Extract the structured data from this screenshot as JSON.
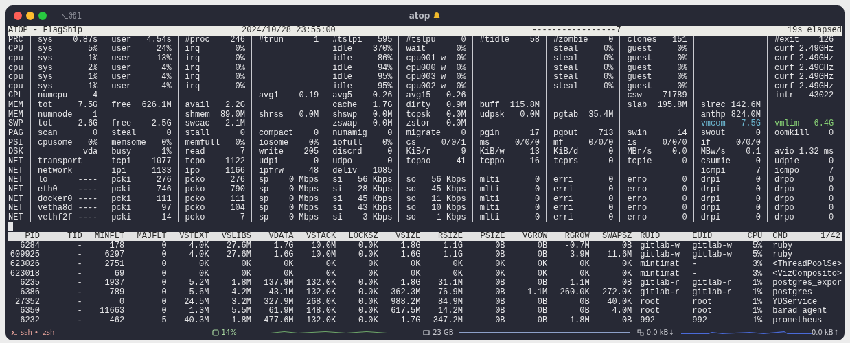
{
  "window": {
    "shortcut": "⌥⌘1",
    "title": "atop"
  },
  "header": {
    "app": "ATOP - FlagShip",
    "datetime": "2024/10/28 23:55:00",
    "interval": "-----------------7",
    "elapsed": "19s elapsed"
  },
  "system": {
    "rows": [
      {
        "label": "PRC",
        "cells": [
          [
            "sys",
            "0.87s"
          ],
          [
            "user",
            "4.54s"
          ],
          [
            "#proc",
            "246"
          ],
          [
            "#trun",
            "1"
          ],
          [
            "#tslpi",
            "595"
          ],
          [
            "#tslpu",
            "0"
          ],
          [
            "#tidle",
            "58"
          ],
          [
            "#zombie",
            "0"
          ],
          [
            "clones",
            "151"
          ],
          null,
          [
            "#exit",
            "126"
          ]
        ]
      },
      {
        "label": "CPU",
        "cells": [
          [
            "sys",
            "5%"
          ],
          [
            "user",
            "24%"
          ],
          [
            "irq",
            "0%"
          ],
          null,
          [
            "idle",
            "370%"
          ],
          [
            "wait",
            "0%"
          ],
          null,
          [
            "steal",
            "0%"
          ],
          [
            "guest",
            "0%"
          ],
          null,
          [
            "curf",
            "2.49GHz"
          ]
        ]
      },
      {
        "label": "cpu",
        "cells": [
          [
            "sys",
            "1%"
          ],
          [
            "user",
            "13%"
          ],
          [
            "irq",
            "0%"
          ],
          null,
          [
            "idle",
            "86%"
          ],
          [
            "cpu001 w",
            "0%"
          ],
          null,
          [
            "steal",
            "0%"
          ],
          [
            "guest",
            "0%"
          ],
          null,
          [
            "curf",
            "2.49GHz"
          ]
        ]
      },
      {
        "label": "cpu",
        "cells": [
          [
            "sys",
            "2%"
          ],
          [
            "user",
            "4%"
          ],
          [
            "irq",
            "0%"
          ],
          null,
          [
            "idle",
            "94%"
          ],
          [
            "cpu000 w",
            "0%"
          ],
          null,
          [
            "steal",
            "0%"
          ],
          [
            "guest",
            "0%"
          ],
          null,
          [
            "curf",
            "2.49GHz"
          ]
        ]
      },
      {
        "label": "cpu",
        "cells": [
          [
            "sys",
            "1%"
          ],
          [
            "user",
            "4%"
          ],
          [
            "irq",
            "0%"
          ],
          null,
          [
            "idle",
            "95%"
          ],
          [
            "cpu003 w",
            "0%"
          ],
          null,
          [
            "steal",
            "0%"
          ],
          [
            "guest",
            "0%"
          ],
          null,
          [
            "curf",
            "2.49GHz"
          ]
        ]
      },
      {
        "label": "cpu",
        "cells": [
          [
            "sys",
            "1%"
          ],
          [
            "user",
            "4%"
          ],
          [
            "irq",
            "0%"
          ],
          null,
          [
            "idle",
            "95%"
          ],
          [
            "cpu002 w",
            "0%"
          ],
          null,
          [
            "steal",
            "0%"
          ],
          [
            "guest",
            "0%"
          ],
          null,
          [
            "curf",
            "2.49GHz"
          ]
        ]
      },
      {
        "label": "CPL",
        "cells": [
          [
            "numcpu",
            "4"
          ],
          null,
          null,
          [
            "avg1",
            "0.19"
          ],
          [
            "avg5",
            "0.26"
          ],
          [
            "avg15",
            "0.26"
          ],
          null,
          null,
          [
            "csw",
            "71789"
          ],
          null,
          [
            "intr",
            "43022"
          ]
        ]
      },
      {
        "label": "MEM",
        "cells": [
          [
            "tot",
            "7.5G"
          ],
          [
            "free",
            "626.1M"
          ],
          [
            "avail",
            "2.2G"
          ],
          null,
          [
            "cache",
            "1.7G"
          ],
          [
            "dirty",
            "0.9M"
          ],
          [
            "buff",
            "115.8M"
          ],
          null,
          [
            "slab",
            "195.8M"
          ],
          [
            "slrec",
            "142.6M"
          ],
          null
        ]
      },
      {
        "label": "MEM",
        "cells": [
          [
            "numnode",
            "1"
          ],
          null,
          [
            "shmem",
            "89.0M"
          ],
          [
            "shrss",
            "0.0M"
          ],
          [
            "shswp",
            "0.0M"
          ],
          [
            "tcpsk",
            "0.0M"
          ],
          [
            "udpsk",
            "0.0M"
          ],
          [
            "pgtab",
            "35.4M"
          ],
          null,
          [
            "anthp",
            "824.0M"
          ],
          null
        ]
      },
      {
        "label": "SWP",
        "cells": [
          [
            "tot",
            "2.6G"
          ],
          [
            "free",
            "2.5G"
          ],
          [
            "swcac",
            "2.1M"
          ],
          null,
          [
            "zswap",
            "0.0M"
          ],
          [
            "zstor",
            "0.0M"
          ],
          null,
          null,
          null,
          {
            "k": "vmcom",
            "v": "7.5G",
            "color": "#6cb6cf"
          },
          {
            "k": "vmlim",
            "v": "6.4G",
            "color": "#86cf74"
          }
        ]
      },
      {
        "label": "PAG",
        "cells": [
          [
            "scan",
            "0"
          ],
          [
            "steal",
            "0"
          ],
          [
            "stall",
            "0"
          ],
          [
            "compact",
            "0"
          ],
          [
            "numamig",
            "0"
          ],
          [
            "migrate",
            "0"
          ],
          [
            "pgin",
            "17"
          ],
          [
            "pgout",
            "713"
          ],
          [
            "swin",
            "14"
          ],
          [
            "swout",
            "0"
          ],
          [
            "oomkill",
            "0"
          ]
        ]
      },
      {
        "label": "PSI",
        "cells": [
          [
            "cpusome",
            "0%"
          ],
          [
            "memsome",
            "0%"
          ],
          [
            "memfull",
            "0%"
          ],
          [
            "iosome",
            "0%"
          ],
          [
            "iofull",
            "0%"
          ],
          [
            "cs",
            "0/0/1"
          ],
          [
            "ms",
            "0/0/0"
          ],
          [
            "mf",
            "0/0/0"
          ],
          [
            "is",
            "0/0/0"
          ],
          [
            "if",
            "0/0/0"
          ],
          null
        ]
      },
      {
        "label": "DSK",
        "cells": [
          [
            null,
            "vda"
          ],
          [
            "busy",
            "1%"
          ],
          [
            "read",
            "7"
          ],
          [
            "write",
            "205"
          ],
          [
            "discrd",
            "0"
          ],
          [
            "KiB/r",
            "9"
          ],
          [
            "KiB/w",
            "13"
          ],
          [
            "KiB/d",
            "0"
          ],
          [
            "MBr/s",
            "0.0"
          ],
          [
            "MBw/s",
            "0.1"
          ],
          [
            "avio",
            "1.32 ms"
          ]
        ]
      },
      {
        "label": "NET",
        "cells": [
          [
            "transport",
            null
          ],
          [
            "tcpi",
            "1077"
          ],
          [
            "tcpo",
            "1122"
          ],
          [
            "udpi",
            "0"
          ],
          [
            "udpo",
            "0"
          ],
          [
            "tcpao",
            "41"
          ],
          [
            "tcppo",
            "16"
          ],
          [
            "tcprs",
            "0"
          ],
          [
            "tcpie",
            "0"
          ],
          [
            "csumie",
            "0"
          ],
          [
            "udpie",
            "0"
          ]
        ]
      },
      {
        "label": "NET",
        "cells": [
          [
            "network",
            null
          ],
          [
            "ipi",
            "1133"
          ],
          [
            "ipo",
            "1166"
          ],
          [
            "ipfrw",
            "48"
          ],
          [
            "deliv",
            "1085"
          ],
          null,
          null,
          null,
          null,
          [
            "icmpi",
            "7"
          ],
          [
            "icmpo",
            "7"
          ]
        ]
      },
      {
        "label": "NET",
        "cells": [
          [
            "lo",
            "----"
          ],
          [
            "pcki",
            "276"
          ],
          [
            "pcko",
            "276"
          ],
          [
            "sp",
            "0 Mbps"
          ],
          [
            "si",
            "56 Kbps"
          ],
          [
            "so",
            "56 Kbps"
          ],
          [
            "mlti",
            "0"
          ],
          [
            "erri",
            "0"
          ],
          [
            "erro",
            "0"
          ],
          [
            "drpi",
            "0"
          ],
          [
            "drpo",
            "0"
          ]
        ]
      },
      {
        "label": "NET",
        "cells": [
          [
            "eth0",
            "----"
          ],
          [
            "pcki",
            "746"
          ],
          [
            "pcko",
            "790"
          ],
          [
            "sp",
            "0 Mbps"
          ],
          [
            "si",
            "28 Kbps"
          ],
          [
            "so",
            "45 Kbps"
          ],
          [
            "mlti",
            "0"
          ],
          [
            "erri",
            "0"
          ],
          [
            "erro",
            "0"
          ],
          [
            "drpi",
            "0"
          ],
          [
            "drpo",
            "0"
          ]
        ]
      },
      {
        "label": "NET",
        "cells": [
          [
            "docker0",
            "----"
          ],
          [
            "pcki",
            "111"
          ],
          [
            "pcko",
            "111"
          ],
          [
            "sp",
            "0 Mbps"
          ],
          [
            "si",
            "45 Kbps"
          ],
          [
            "so",
            "11 Kbps"
          ],
          [
            "mlti",
            "0"
          ],
          [
            "erri",
            "0"
          ],
          [
            "erro",
            "0"
          ],
          [
            "drpi",
            "0"
          ],
          [
            "drpo",
            "0"
          ]
        ]
      },
      {
        "label": "NET",
        "cells": [
          [
            "vetha8d",
            "----"
          ],
          [
            "pcki",
            "97"
          ],
          [
            "pcko",
            "104"
          ],
          [
            "sp",
            "0 Mbps"
          ],
          [
            "si",
            "43 Kbps"
          ],
          [
            "so",
            "10 Kbps"
          ],
          [
            "mlti",
            "0"
          ],
          [
            "erri",
            "0"
          ],
          [
            "erro",
            "0"
          ],
          [
            "drpi",
            "0"
          ],
          [
            "drpo",
            "0"
          ]
        ]
      },
      {
        "label": "NET",
        "cells": [
          [
            "vethf2f",
            "----"
          ],
          [
            "pcki",
            "14"
          ],
          [
            "pcko",
            "7"
          ],
          [
            "sp",
            "0 Mbps"
          ],
          [
            "si",
            "3 Kbps"
          ],
          [
            "so",
            "1 Kbps"
          ],
          [
            "mlti",
            "0"
          ],
          [
            "erri",
            "0"
          ],
          [
            "erro",
            "0"
          ],
          [
            "drpi",
            "0"
          ],
          [
            "drpo",
            "0"
          ]
        ]
      }
    ]
  },
  "process_table": {
    "columns": [
      "PID",
      "TID",
      "MINFLT",
      "MAJFLT",
      "VSTEXT",
      "VSLIBS",
      "VDATA",
      "VSTACK",
      "LOCKSZ",
      "VSIZE",
      "RSIZE",
      "PSIZE",
      "VGROW",
      "RGROW",
      "SWAPSZ",
      "RUID",
      "EUID",
      "CPU",
      "CMD"
    ],
    "page": "1/42",
    "rows": [
      [
        "6284",
        "-",
        "178",
        "0",
        "4.0K",
        "27.6M",
        "1.7G",
        "10.0M",
        "0.0K",
        "1.8G",
        "1.1G",
        "0B",
        "0B",
        "-0.7M",
        "0B",
        "gitlab-w",
        "gitlab-w",
        "5%",
        "ruby"
      ],
      [
        "609925",
        "-",
        "6297",
        "0",
        "4.0K",
        "27.6M",
        "1.6G",
        "10.0M",
        "0.0K",
        "1.6G",
        "1.1G",
        "0B",
        "0B",
        "3.9M",
        "11.6M",
        "gitlab-w",
        "gitlab-w",
        "5%",
        "ruby"
      ],
      [
        "623026",
        "-",
        "2751",
        "0",
        "0K",
        "0K",
        "0K",
        "0K",
        "0K",
        "0K",
        "0K",
        "0K",
        "0K",
        "0K",
        "0K",
        "mintimat",
        "-",
        "3%",
        "<ThreadPoolSe>"
      ],
      [
        "623018",
        "-",
        "69",
        "0",
        "0K",
        "0K",
        "0K",
        "0K",
        "0K",
        "0K",
        "0K",
        "0K",
        "0K",
        "0K",
        "0K",
        "mintimat",
        "-",
        "3%",
        "<VizComposito>"
      ],
      [
        "6235",
        "-",
        "1937",
        "0",
        "5.2M",
        "1.8M",
        "137.9M",
        "132.0K",
        "0.0K",
        "1.8G",
        "31.1M",
        "0B",
        "0B",
        "1.1M",
        "0B",
        "gitlab-r",
        "gitlab-r",
        "1%",
        "postgres_expor"
      ],
      [
        "6386",
        "-",
        "789",
        "0",
        "5.6M",
        "4.2M",
        "43.1M",
        "132.0K",
        "0.0K",
        "362.3M",
        "76.9M",
        "0B",
        "1.1M",
        "260.0K",
        "272.0K",
        "gitlab-r",
        "gitlab-r",
        "1%",
        "postgres"
      ],
      [
        "27352",
        "-",
        "0",
        "0",
        "24.5M",
        "3.2M",
        "327.9M",
        "268.0K",
        "0.0K",
        "988.2M",
        "84.9M",
        "0B",
        "0B",
        "0B",
        "40.0K",
        "root",
        "root",
        "1%",
        "YDService"
      ],
      [
        "6350",
        "-",
        "11663",
        "0",
        "1.3M",
        "5.5M",
        "61.9M",
        "148.0K",
        "0.0K",
        "617.5M",
        "14.2M",
        "0B",
        "0B",
        "0B",
        "4.0M",
        "root",
        "root",
        "1%",
        "barad_agent"
      ],
      [
        "6232",
        "-",
        "462",
        "5",
        "40.3M",
        "1.8M",
        "477.6M",
        "132.0K",
        "0.0K",
        "1.7G",
        "347.2M",
        "0B",
        "0B",
        "1.8M",
        "0B",
        "992",
        "992",
        "1%",
        "prometheus"
      ]
    ]
  },
  "status_bar": {
    "session": "ssh • -zsh",
    "cpu": "14%",
    "memory": "23 GB",
    "net_down": "0.0 kB↓",
    "net_up": "0.0 kB↑"
  }
}
